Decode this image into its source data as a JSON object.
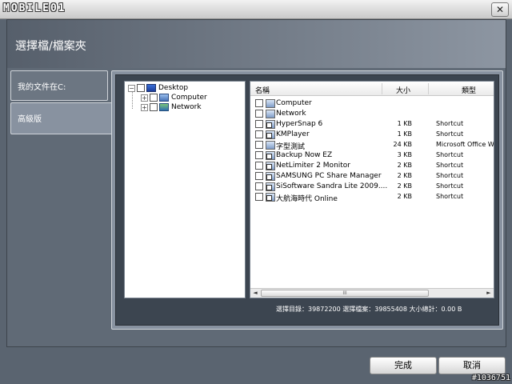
{
  "window": {
    "logo": "MOBILE01",
    "close_glyph": "✕"
  },
  "header": {
    "title": "選擇檔/檔案夾"
  },
  "side_tabs": [
    {
      "label": "我的文件在C:"
    },
    {
      "label": "高級版"
    }
  ],
  "tree": {
    "root": {
      "label": "Desktop",
      "expander": "−"
    },
    "children": [
      {
        "label": "Computer",
        "expander": "+"
      },
      {
        "label": "Network",
        "expander": "+"
      }
    ]
  },
  "file_list": {
    "columns": {
      "name": "名稱",
      "size": "大小",
      "type": "類型"
    },
    "rows": [
      {
        "name": "Computer",
        "size": "",
        "type": ""
      },
      {
        "name": "Network",
        "size": "",
        "type": ""
      },
      {
        "name": "HyperSnap 6",
        "size": "1 KB",
        "type": "Shortcut"
      },
      {
        "name": "KMPlayer",
        "size": "1 KB",
        "type": "Shortcut"
      },
      {
        "name": "字型測試",
        "size": "24 KB",
        "type": "Microsoft Office W"
      },
      {
        "name": "Backup Now EZ",
        "size": "3 KB",
        "type": "Shortcut"
      },
      {
        "name": "NetLimiter 2 Monitor",
        "size": "2 KB",
        "type": "Shortcut"
      },
      {
        "name": "SAMSUNG PC Share Manager",
        "size": "2 KB",
        "type": "Shortcut"
      },
      {
        "name": "SiSoftware Sandra Lite 2009....",
        "size": "2 KB",
        "type": "Shortcut"
      },
      {
        "name": "大航海時代 Online",
        "size": "2 KB",
        "type": "Shortcut"
      }
    ],
    "scroll_left": "◄",
    "scroll_right": "►",
    "scroll_thumb": "III"
  },
  "summary": "選擇目錄：39872200 選擇檔案：39855408 大小總計：0.00 B",
  "buttons": {
    "done": "完成",
    "cancel": "取消"
  },
  "watermark": "#1036751"
}
